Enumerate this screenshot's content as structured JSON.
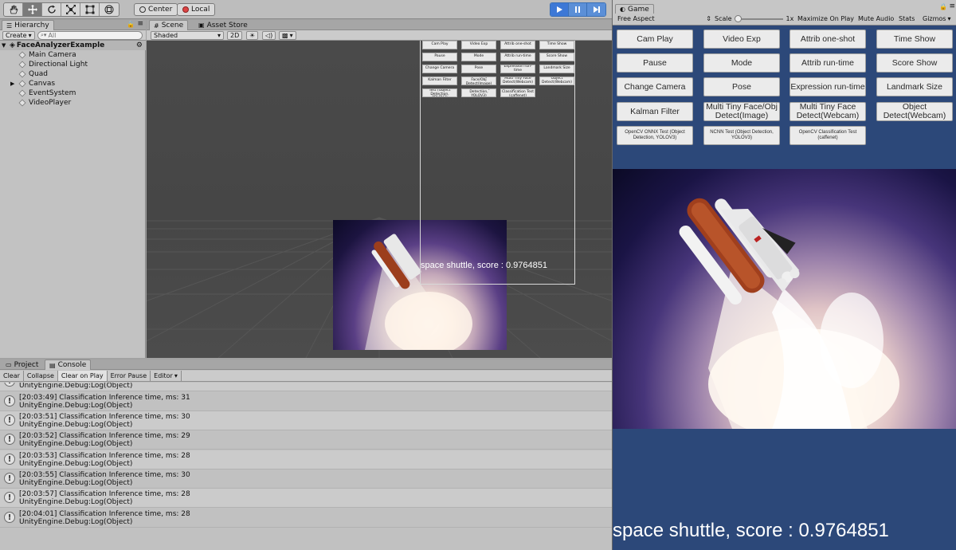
{
  "toolbar": {
    "pivot_label": "Center",
    "space_label": "Local"
  },
  "hierarchy": {
    "tab_label": "Hierarchy",
    "create_label": "Create",
    "search_placeholder": "All",
    "scene_name": "FaceAnalyzerExample",
    "items": [
      "Main Camera",
      "Directional Light",
      "Quad",
      "Canvas",
      "EventSystem",
      "VideoPlayer"
    ]
  },
  "scene": {
    "tab_label": "Scene",
    "asset_tab_label": "Asset Store",
    "shading_label": "Shaded",
    "mode_2d_label": "2D",
    "overlay_text": "space shuttle, score : 0.9764851"
  },
  "console": {
    "project_tab_label": "Project",
    "console_tab_label": "Console",
    "buttons": [
      "Clear",
      "Collapse",
      "Clear on Play",
      "Error Pause",
      "Editor"
    ],
    "logs": [
      {
        "line1": "",
        "line2": "UnityEngine.Debug:Log(Object)"
      },
      {
        "line1": "[20:03:49] Classification Inference time, ms: 31",
        "line2": "UnityEngine.Debug:Log(Object)"
      },
      {
        "line1": "[20:03:51] Classification Inference time, ms: 30",
        "line2": "UnityEngine.Debug:Log(Object)"
      },
      {
        "line1": "[20:03:52] Classification Inference time, ms: 29",
        "line2": "UnityEngine.Debug:Log(Object)"
      },
      {
        "line1": "[20:03:53] Classification Inference time, ms: 28",
        "line2": "UnityEngine.Debug:Log(Object)"
      },
      {
        "line1": "[20:03:55] Classification Inference time, ms: 30",
        "line2": "UnityEngine.Debug:Log(Object)"
      },
      {
        "line1": "[20:03:57] Classification Inference time, ms: 28",
        "line2": "UnityEngine.Debug:Log(Object)"
      },
      {
        "line1": "[20:04:01] Classification Inference time, ms: 28",
        "line2": "UnityEngine.Debug:Log(Object)"
      }
    ]
  },
  "game": {
    "tab_label": "Game",
    "aspect_label": "Free Aspect",
    "scale_label": "Scale",
    "scale_value": "1x",
    "maximize_label": "Maximize On Play",
    "mute_label": "Mute Audio",
    "stats_label": "Stats",
    "gizmos_label": "Gizmos",
    "buttons": [
      "Cam Play",
      "Video Exp",
      "Attrib one-shot",
      "Time Show",
      "Pause",
      "Mode",
      "Attrib run-time",
      "Score Show",
      "Change Camera",
      "Pose",
      "Expression run-time",
      "Landmark Size",
      "Kalman Filter",
      "Multi Tiny Face/Obj Detect(Image)",
      "Multi Tiny Face Detect(Webcam)",
      "Object Detect(Webcam)",
      "OpenCV ONNX Test (Object Detection, YOLOV3)",
      "NCNN Test (Object Detection, YOLOV3)",
      "OpenCV Classification Test (caffenet)"
    ],
    "result_text": "space shuttle, score : 0.9764851"
  },
  "colors": {
    "game_background": "#2c4879",
    "play_accent": "#3d78d6",
    "editor_gray": "#c2c2c2"
  }
}
